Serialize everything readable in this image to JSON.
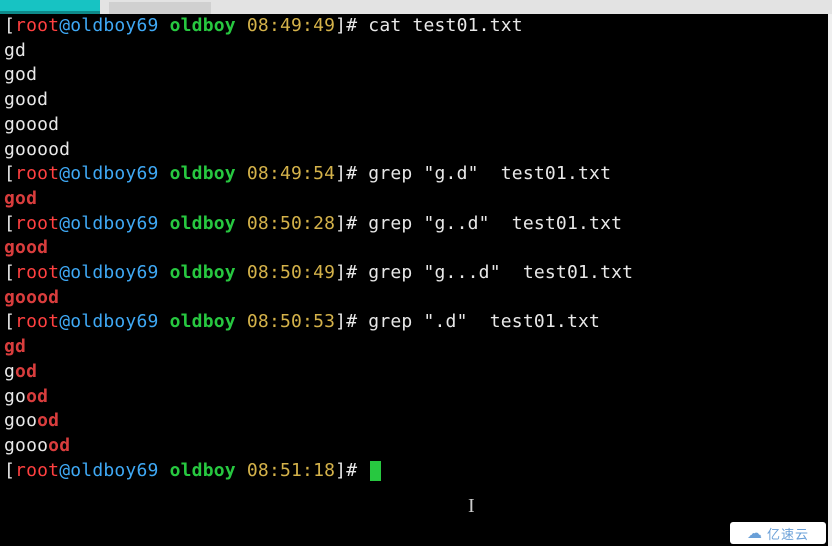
{
  "prompt_template": {
    "open_bracket": "[",
    "root": "root",
    "at": "@",
    "host": "oldboy69",
    "dir": "oldboy",
    "close_bracket": "]",
    "symbol": "# "
  },
  "lines": [
    {
      "type": "prompt",
      "time": "08:49:49",
      "command": "cat test01.txt"
    },
    {
      "type": "plain",
      "text": "gd"
    },
    {
      "type": "plain",
      "text": "god"
    },
    {
      "type": "plain",
      "text": "good"
    },
    {
      "type": "plain",
      "text": "goood"
    },
    {
      "type": "plain",
      "text": "gooood"
    },
    {
      "type": "prompt",
      "time": "08:49:54",
      "command": "grep \"g.d\"  test01.txt"
    },
    {
      "type": "match",
      "highlight": "god",
      "suffix": ""
    },
    {
      "type": "prompt",
      "time": "08:50:28",
      "command": "grep \"g..d\"  test01.txt"
    },
    {
      "type": "match",
      "highlight": "good",
      "suffix": ""
    },
    {
      "type": "prompt",
      "time": "08:50:49",
      "command": "grep \"g...d\"  test01.txt"
    },
    {
      "type": "match",
      "highlight": "goood",
      "suffix": ""
    },
    {
      "type": "prompt",
      "time": "08:50:53",
      "command": "grep \".d\"  test01.txt"
    },
    {
      "type": "match",
      "prefix": "",
      "highlight": "gd",
      "suffix": ""
    },
    {
      "type": "match",
      "prefix": "g",
      "highlight": "od",
      "suffix": ""
    },
    {
      "type": "match",
      "prefix": "go",
      "highlight": "od",
      "suffix": ""
    },
    {
      "type": "match",
      "prefix": "goo",
      "highlight": "od",
      "suffix": ""
    },
    {
      "type": "match",
      "prefix": "gooo",
      "highlight": "od",
      "suffix": ""
    },
    {
      "type": "prompt",
      "time": "08:51:18",
      "command": "",
      "cursor": true
    }
  ],
  "watermark": {
    "icon": "☁",
    "text": "亿速云"
  },
  "mouse_ibeam": "I"
}
